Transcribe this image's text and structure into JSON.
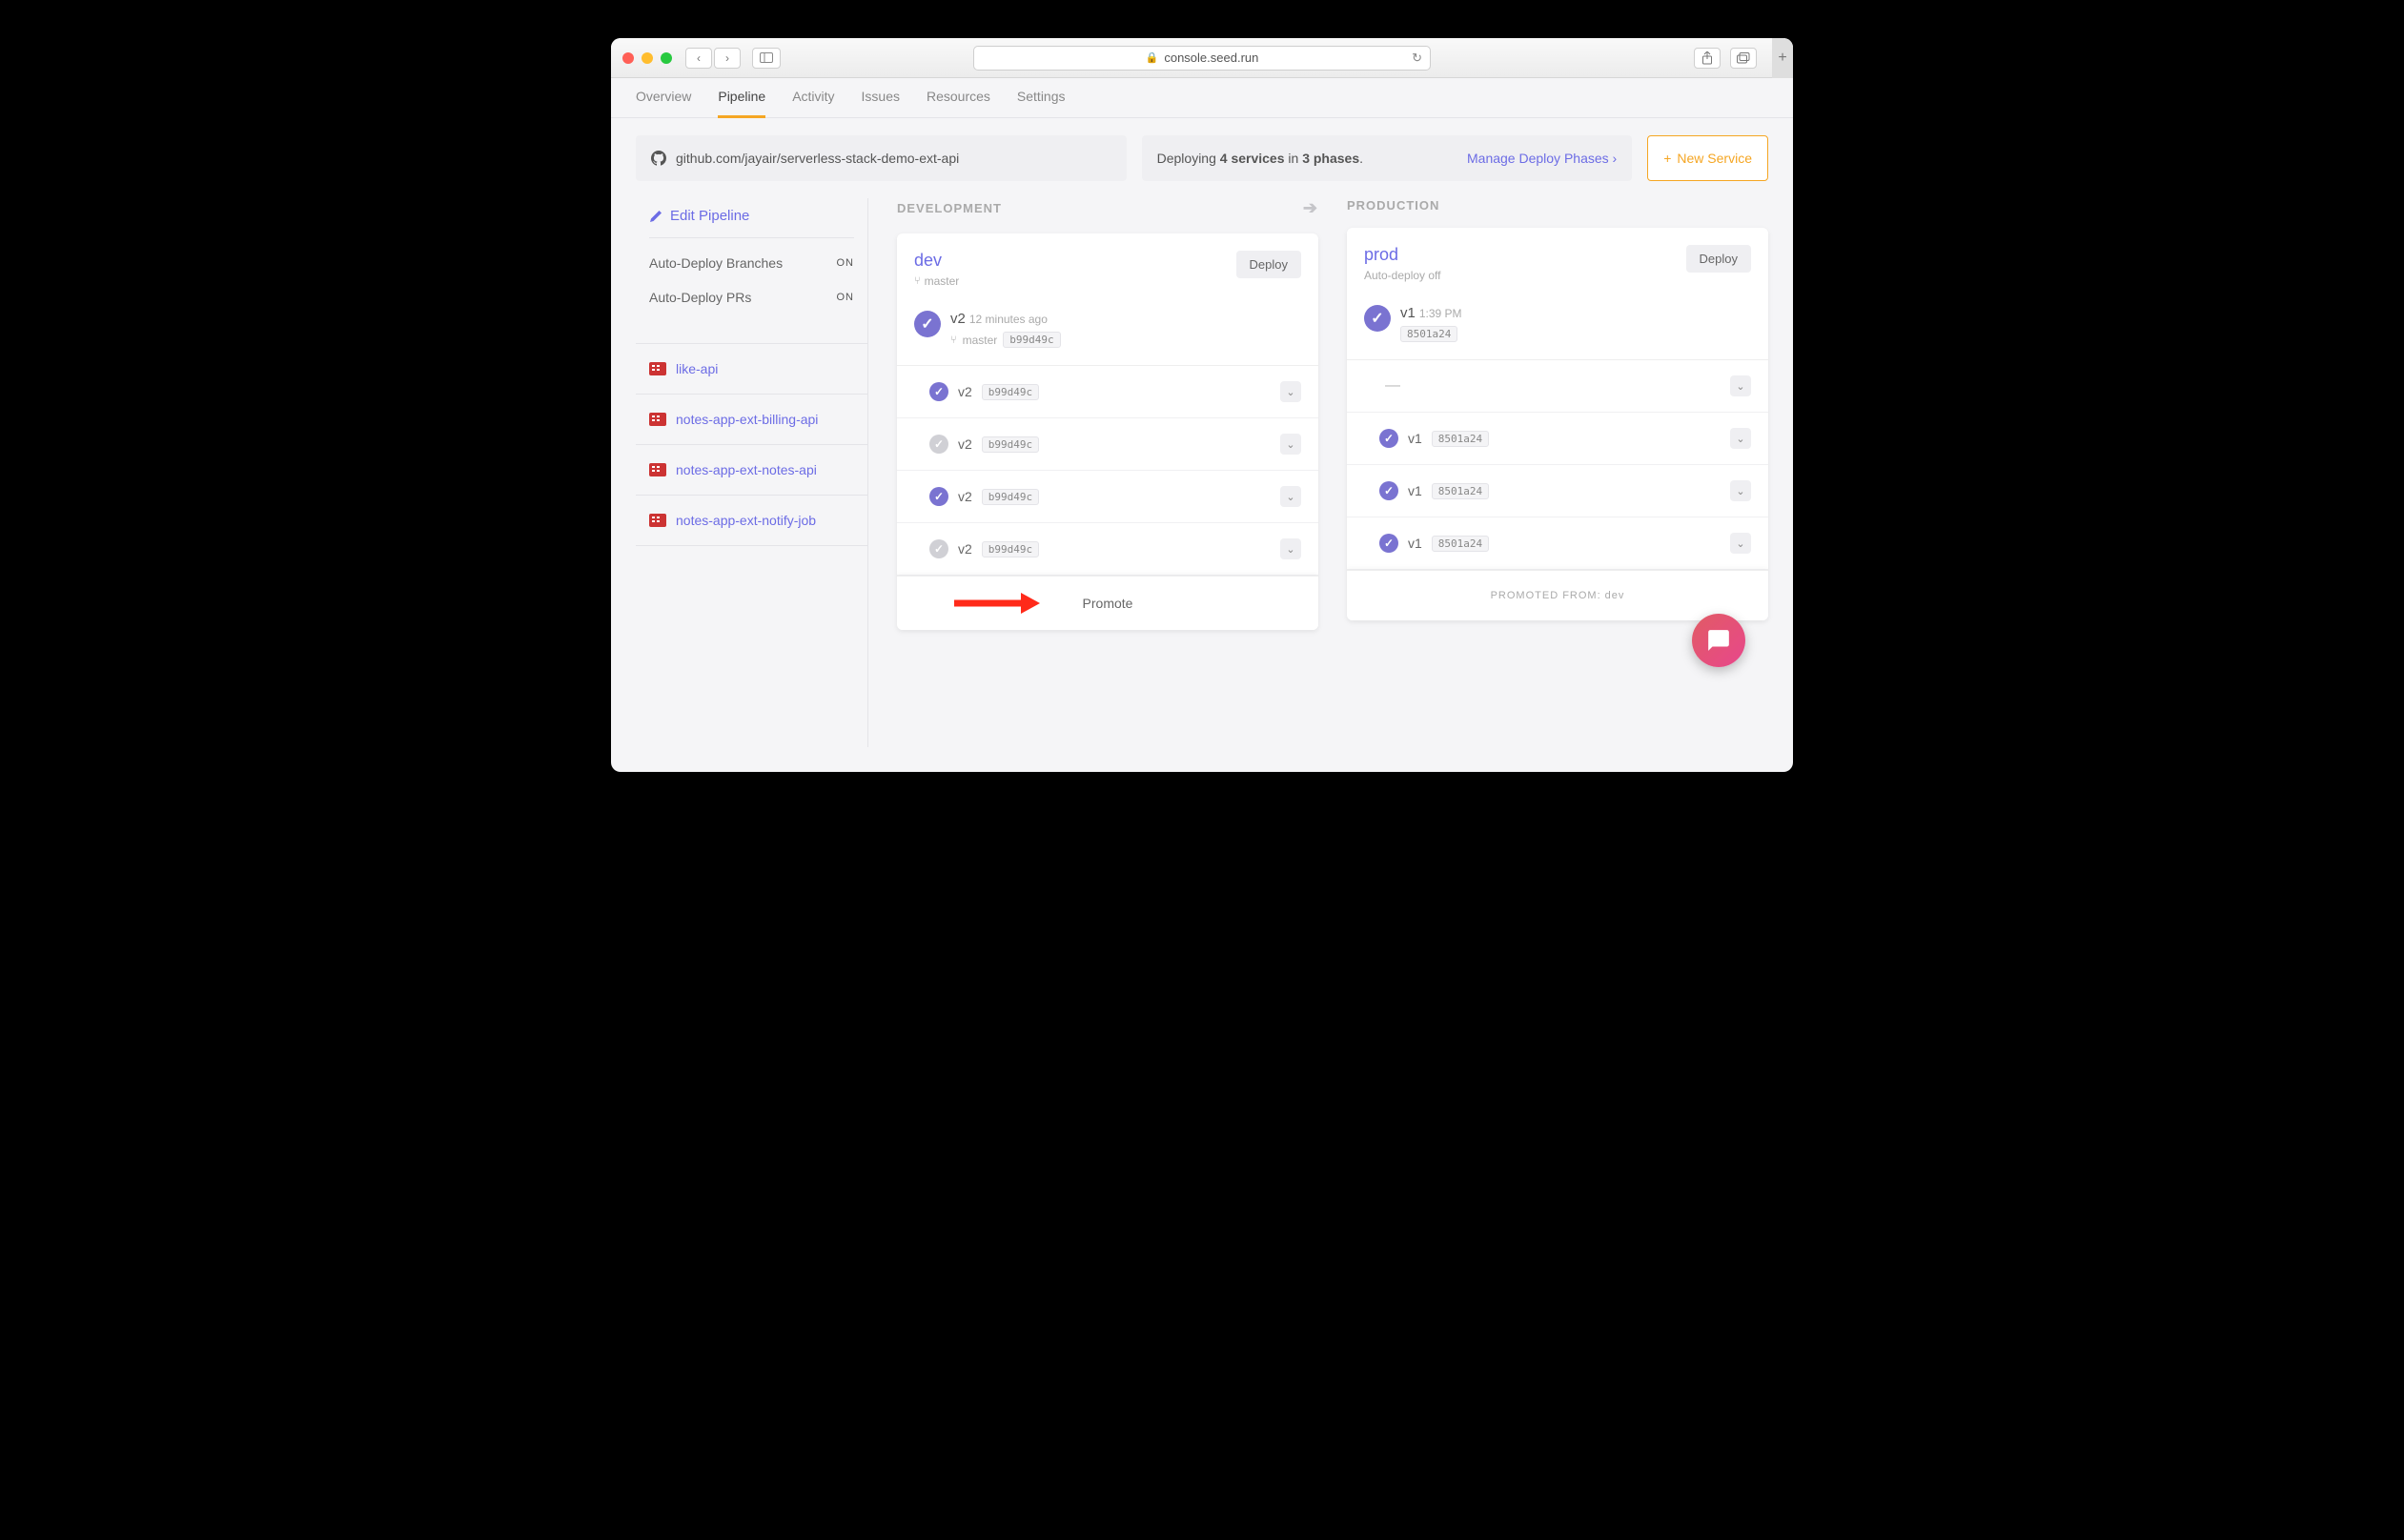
{
  "browser": {
    "url": "console.seed.run"
  },
  "nav": {
    "tabs": [
      "Overview",
      "Pipeline",
      "Activity",
      "Issues",
      "Resources",
      "Settings"
    ],
    "active": "Pipeline"
  },
  "repo": {
    "url": "github.com/jayair/serverless-stack-demo-ext-api"
  },
  "deploying": {
    "prefix": "Deploying ",
    "services": "4 services",
    "mid": " in ",
    "phases": "3 phases",
    "suffix": ".",
    "manage": "Manage Deploy Phases"
  },
  "newservice": "New Service",
  "sidebar": {
    "edit": "Edit Pipeline",
    "settings": [
      {
        "label": "Auto-Deploy Branches",
        "value": "ON"
      },
      {
        "label": "Auto-Deploy PRs",
        "value": "ON"
      }
    ],
    "services": [
      "like-api",
      "notes-app-ext-billing-api",
      "notes-app-ext-notes-api",
      "notes-app-ext-notify-job"
    ]
  },
  "stages": {
    "dev": {
      "label": "DEVELOPMENT",
      "name": "dev",
      "branch": "master",
      "deploy": "Deploy",
      "version": "v2",
      "time": "12 minutes ago",
      "hash": "b99d49c",
      "rows": [
        {
          "v": "v2",
          "hash": "b99d49c",
          "state": "purple"
        },
        {
          "v": "v2",
          "hash": "b99d49c",
          "state": "grey"
        },
        {
          "v": "v2",
          "hash": "b99d49c",
          "state": "purple"
        },
        {
          "v": "v2",
          "hash": "b99d49c",
          "state": "grey"
        }
      ],
      "footer": "Promote"
    },
    "prod": {
      "label": "PRODUCTION",
      "name": "prod",
      "branch": "Auto-deploy off",
      "deploy": "Deploy",
      "version": "v1",
      "time": "1:39 PM",
      "hash": "8501a24",
      "rows": [
        {
          "empty": true
        },
        {
          "v": "v1",
          "hash": "8501a24",
          "state": "purple"
        },
        {
          "v": "v1",
          "hash": "8501a24",
          "state": "purple"
        },
        {
          "v": "v1",
          "hash": "8501a24",
          "state": "purple"
        }
      ],
      "footer": "PROMOTED FROM: dev"
    }
  }
}
